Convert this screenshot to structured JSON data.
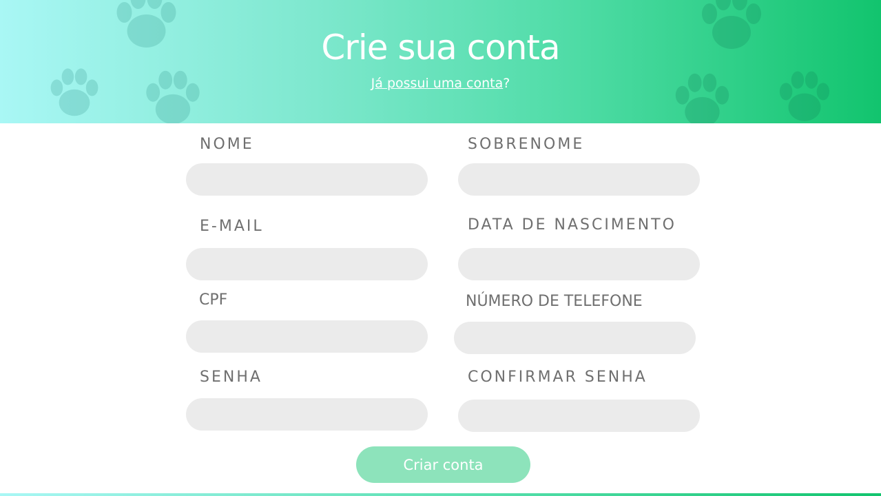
{
  "header": {
    "title": "Crie sua conta",
    "login_link": "Já possui uma conta",
    "login_suffix": "?"
  },
  "form": {
    "nome_label": "NOME",
    "sobrenome_label": "SOBRENOME",
    "email_label": "E-MAIL",
    "nascimento_label": "DATA DE NASCIMENTO",
    "cpf_label": "CPF",
    "telefone_label": "NÚMERO DE TELEFONE",
    "senha_label": "SENHA",
    "confirmar_label": "CONFIRMAR SENHA",
    "nome_value": "",
    "sobrenome_value": "",
    "email_value": "",
    "nascimento_value": "",
    "cpf_value": "",
    "telefone_value": "",
    "senha_value": "",
    "confirmar_value": "",
    "submit_label": "Criar conta"
  },
  "colors": {
    "gradient_start": "#a9f7f5",
    "gradient_end": "#12c46e",
    "field_bg": "#ebebeb",
    "label": "#6f6f6f",
    "button_bg": "#8de3bb"
  },
  "icons": [
    "paw-print-icon"
  ]
}
